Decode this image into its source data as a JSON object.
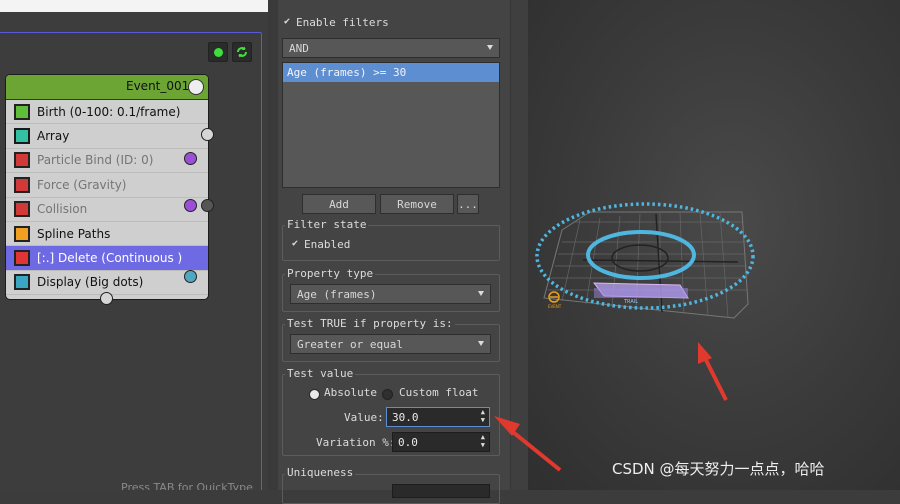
{
  "graph": {
    "event_title": "Event_001",
    "operators": [
      {
        "label": "Birth (0-100: 0.1/frame)",
        "icon": "birth-icon",
        "state": "normal"
      },
      {
        "label": "Array",
        "icon": "array-icon",
        "state": "normal"
      },
      {
        "label": "Particle Bind (ID: 0)",
        "icon": "particle-bind-icon",
        "state": "disabled"
      },
      {
        "label": "Force (Gravity)",
        "icon": "force-icon",
        "state": "disabled"
      },
      {
        "label": "Collision",
        "icon": "collision-icon",
        "state": "disabled"
      },
      {
        "label": "Spline Paths",
        "icon": "spline-paths-icon",
        "state": "normal"
      },
      {
        "label": "[:.] Delete (Continuous )",
        "icon": "delete-icon",
        "state": "selected"
      },
      {
        "label": "Display (Big dots)",
        "icon": "display-icon",
        "state": "normal"
      }
    ],
    "footer_hint": "Press TAB for QuickType",
    "colors": {
      "node_header": "#6ca533",
      "selected_row": "#6e6ae4",
      "frame_border": "#5a5ad8",
      "socket_purple": "#9b4fd6",
      "socket_teal": "#4fa7c2"
    }
  },
  "panel": {
    "enable_filters_label": "Enable filters",
    "enable_filters_checked": true,
    "logic_value": "AND",
    "filters": [
      "Age (frames) >= 30"
    ],
    "add_label": "Add",
    "remove_label": "Remove",
    "more_label": "...",
    "filter_state": {
      "title": "Filter state",
      "enabled_label": "Enabled",
      "checked": true
    },
    "property_type": {
      "title": "Property type",
      "value": "Age (frames)"
    },
    "test_true": {
      "title": "Test TRUE if property is:",
      "value": "Greater or equal"
    },
    "test_value": {
      "title": "Test value",
      "absolute_label": "Absolute",
      "custom_label": "Custom float",
      "selected": "Absolute",
      "value_label": "Value:",
      "value": "30.0",
      "variation_label": "Variation %:",
      "variation": "0.0"
    },
    "uniqueness_title": "Uniqueness"
  },
  "viewport": {
    "watermark": "CSDN @每天努力一点点，哈哈",
    "colors": {
      "ring": "#4fb6e0",
      "grid": "#6b6b6b",
      "arrow": "#e0392d",
      "emitter": "#d9b4ff"
    }
  }
}
